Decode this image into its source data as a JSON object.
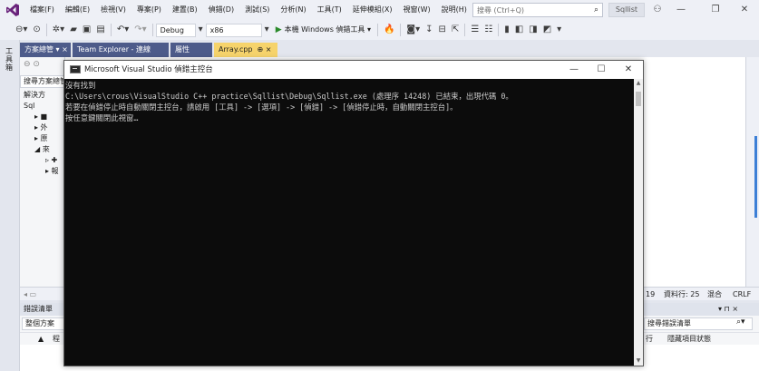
{
  "menu": {
    "items": [
      "檔案(F)",
      "編輯(E)",
      "檢視(V)",
      "專案(P)",
      "建置(B)",
      "偵錯(D)",
      "測試(S)",
      "分析(N)",
      "工具(T)",
      "延伸模組(X)",
      "視窗(W)",
      "說明(H)"
    ],
    "search_placeholder": "搜尋 (Ctrl+Q)",
    "solution_name": "Sqllist"
  },
  "window_controls": {
    "minimize": "—",
    "restore": "❐",
    "close": "✕",
    "live_share": "⚇"
  },
  "toolbar": {
    "config": "Debug",
    "platform": "x86",
    "run_label": "本機 Windows 偵錯工具"
  },
  "left_strip": {
    "label": "工具箱"
  },
  "tabs": [
    {
      "label": "方案總管 ▾ ×",
      "active": false
    },
    {
      "label": "Team Explorer - 連線",
      "active": false
    },
    {
      "label": "屬性",
      "active": false
    },
    {
      "label": "Array.cpp",
      "active": true,
      "close": "⊕ ×"
    }
  ],
  "solution_explorer": {
    "search_placeholder": "搜尋方案總管",
    "rows": [
      "解決方",
      "Sql",
      "▸ ■",
      "▸ 外",
      "▸ 原",
      "◢ 來",
      "▹ ✚",
      "▸ 報"
    ]
  },
  "status": {
    "line_info": "19",
    "char_info": "資料行: 25",
    "mixed": "混合",
    "line_ending": "CRLF"
  },
  "error_list": {
    "title": "錯誤清單",
    "scope": "整個方案",
    "search_placeholder": "搜尋錯誤清單",
    "columns": [
      "▲",
      "程",
      "行",
      "隱藏項目狀態"
    ],
    "panel_controls": "▾ ⊓ ×"
  },
  "console": {
    "title": "Microsoft Visual Studio 偵錯主控台",
    "lines": [
      "沒有找到",
      "C:\\Users\\crous\\VisualStudio C++ practice\\Sqllist\\Debug\\Sqllist.exe (處理序 14248) 已結束，出現代碼 0。",
      "若要在偵錯停止時自動關閉主控台，請啟用 [工具] -> [選項] -> [偵錯] -> [偵錯停止時，自動關閉主控台]。",
      "按任意鍵關閉此視窗…"
    ],
    "controls": {
      "minimize": "—",
      "maximize": "☐",
      "close": "✕"
    }
  },
  "colors": {
    "accent_tab": "#f6d36b",
    "inactive_tab": "#4d5b8a",
    "console_bg": "#0c0c0c",
    "console_text": "#cccccc",
    "run_green": "#2a8a2a"
  }
}
